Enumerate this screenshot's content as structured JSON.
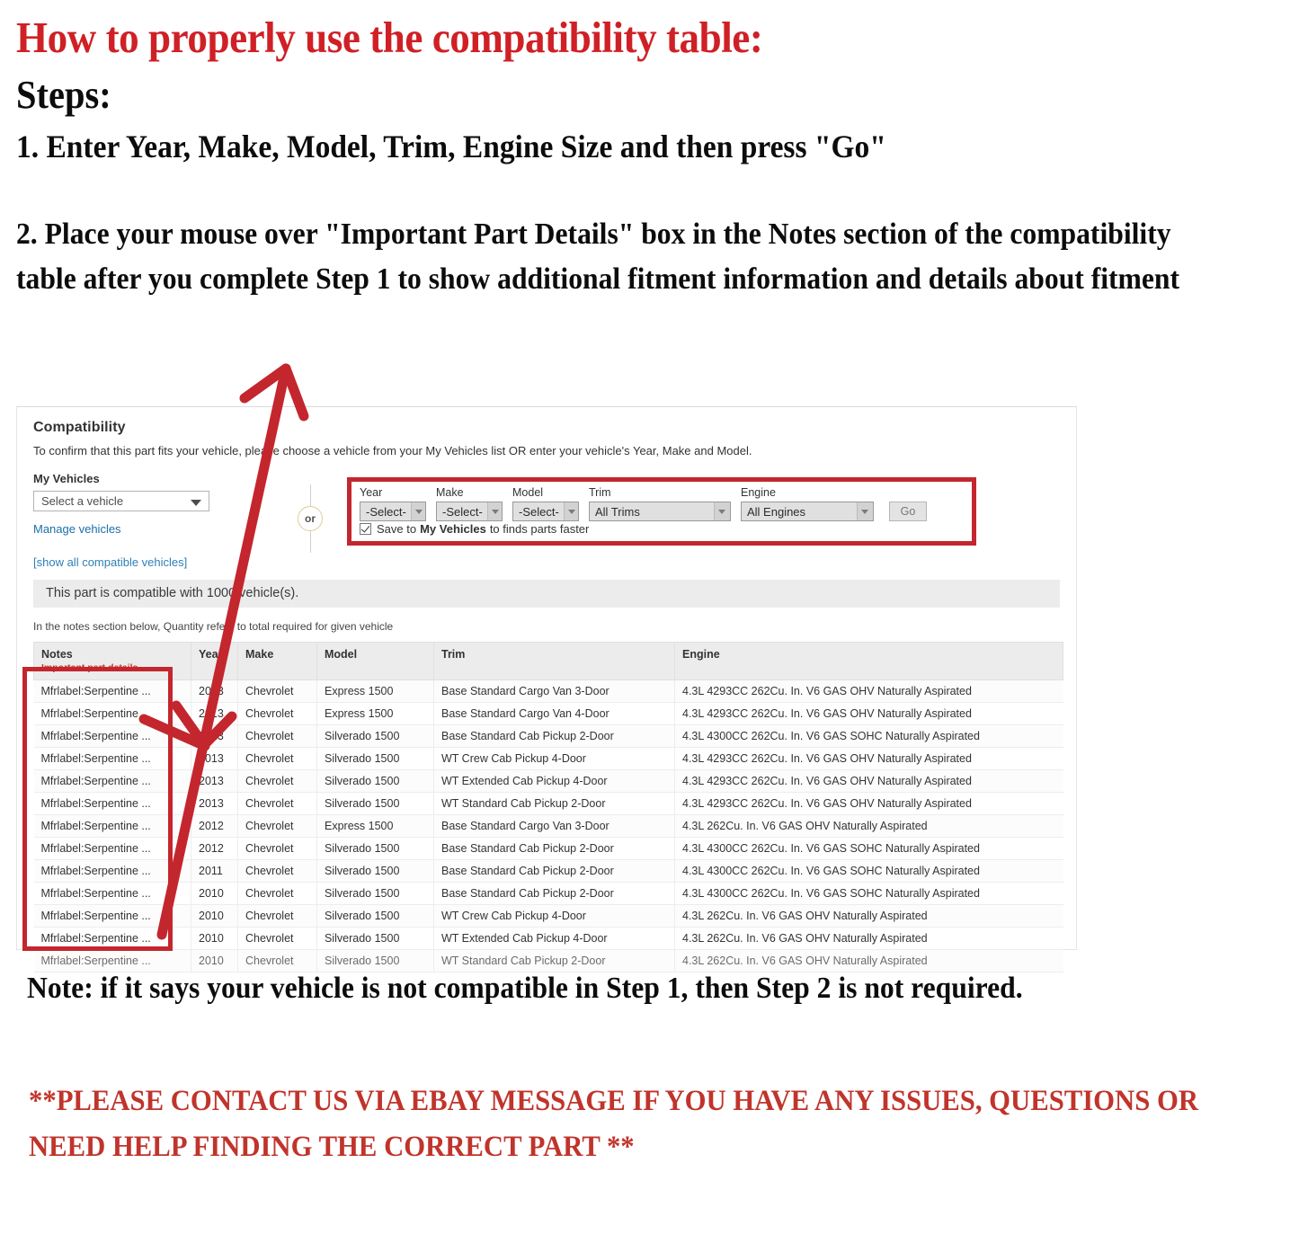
{
  "instructions": {
    "heading": "How to properly use the compatibility table:",
    "steps_label": "Steps:",
    "step1": "1. Enter Year, Make, Model, Trim, Engine Size and then press \"Go\"",
    "step2": "2. Place your mouse over \"Important Part Details\" box in the Notes section of the compatibility table after you complete Step 1 to show additional fitment information and details about fitment"
  },
  "compatibility": {
    "title": "Compatibility",
    "subtitle": "To confirm that this part fits your vehicle, please choose a vehicle from your My Vehicles list OR enter your vehicle's Year, Make and Model.",
    "my_vehicles_label": "My Vehicles",
    "vehicle_select_value": "Select a vehicle",
    "manage_vehicles_link": "Manage vehicles",
    "show_all_link": "[show all compatible vehicles]",
    "or_label": "or",
    "form": {
      "year_label": "Year",
      "year_value": "-Select-",
      "make_label": "Make",
      "make_value": "-Select-",
      "model_label": "Model",
      "model_value": "-Select-",
      "trim_label": "Trim",
      "trim_value": "All Trims",
      "engine_label": "Engine",
      "engine_value": "All Engines",
      "go_button": "Go",
      "save_prefix": "Save to",
      "save_bold": "My Vehicles",
      "save_suffix": "to finds parts faster"
    },
    "count_bar": "This part is compatible with 1000 vehicle(s).",
    "notes_hint": "In the notes section below, Quantity refers to total required for given vehicle",
    "table": {
      "headers": {
        "notes": "Notes",
        "notes_sub": "Important part details",
        "year": "Year",
        "make": "Make",
        "model": "Model",
        "trim": "Trim",
        "engine": "Engine"
      },
      "rows": [
        {
          "notes": "Mfrlabel:Serpentine ...",
          "year": "2013",
          "make": "Chevrolet",
          "model": "Express 1500",
          "trim": "Base Standard Cargo Van 3-Door",
          "engine": "4.3L 4293CC 262Cu. In. V6 GAS OHV Naturally Aspirated"
        },
        {
          "notes": "Mfrlabel:Serpentine ...",
          "year": "2013",
          "make": "Chevrolet",
          "model": "Express 1500",
          "trim": "Base Standard Cargo Van 4-Door",
          "engine": "4.3L 4293CC 262Cu. In. V6 GAS OHV Naturally Aspirated"
        },
        {
          "notes": "Mfrlabel:Serpentine ...",
          "year": "2013",
          "make": "Chevrolet",
          "model": "Silverado 1500",
          "trim": "Base Standard Cab Pickup 2-Door",
          "engine": "4.3L 4300CC 262Cu. In. V6 GAS SOHC Naturally Aspirated"
        },
        {
          "notes": "Mfrlabel:Serpentine ...",
          "year": "2013",
          "make": "Chevrolet",
          "model": "Silverado 1500",
          "trim": "WT Crew Cab Pickup 4-Door",
          "engine": "4.3L 4293CC 262Cu. In. V6 GAS OHV Naturally Aspirated"
        },
        {
          "notes": "Mfrlabel:Serpentine ...",
          "year": "2013",
          "make": "Chevrolet",
          "model": "Silverado 1500",
          "trim": "WT Extended Cab Pickup 4-Door",
          "engine": "4.3L 4293CC 262Cu. In. V6 GAS OHV Naturally Aspirated"
        },
        {
          "notes": "Mfrlabel:Serpentine ...",
          "year": "2013",
          "make": "Chevrolet",
          "model": "Silverado 1500",
          "trim": "WT Standard Cab Pickup 2-Door",
          "engine": "4.3L 4293CC 262Cu. In. V6 GAS OHV Naturally Aspirated"
        },
        {
          "notes": "Mfrlabel:Serpentine ...",
          "year": "2012",
          "make": "Chevrolet",
          "model": "Express 1500",
          "trim": "Base Standard Cargo Van 3-Door",
          "engine": "4.3L 262Cu. In. V6 GAS OHV Naturally Aspirated"
        },
        {
          "notes": "Mfrlabel:Serpentine ...",
          "year": "2012",
          "make": "Chevrolet",
          "model": "Silverado 1500",
          "trim": "Base Standard Cab Pickup 2-Door",
          "engine": "4.3L 4300CC 262Cu. In. V6 GAS SOHC Naturally Aspirated"
        },
        {
          "notes": "Mfrlabel:Serpentine ...",
          "year": "2011",
          "make": "Chevrolet",
          "model": "Silverado 1500",
          "trim": "Base Standard Cab Pickup 2-Door",
          "engine": "4.3L 4300CC 262Cu. In. V6 GAS SOHC Naturally Aspirated"
        },
        {
          "notes": "Mfrlabel:Serpentine ...",
          "year": "2010",
          "make": "Chevrolet",
          "model": "Silverado 1500",
          "trim": "Base Standard Cab Pickup 2-Door",
          "engine": "4.3L 4300CC 262Cu. In. V6 GAS SOHC Naturally Aspirated"
        },
        {
          "notes": "Mfrlabel:Serpentine ...",
          "year": "2010",
          "make": "Chevrolet",
          "model": "Silverado 1500",
          "trim": "WT Crew Cab Pickup 4-Door",
          "engine": "4.3L 262Cu. In. V6 GAS OHV Naturally Aspirated"
        },
        {
          "notes": "Mfrlabel:Serpentine ...",
          "year": "2010",
          "make": "Chevrolet",
          "model": "Silverado 1500",
          "trim": "WT Extended Cab Pickup 4-Door",
          "engine": "4.3L 262Cu. In. V6 GAS OHV Naturally Aspirated"
        },
        {
          "notes": "Mfrlabel:Serpentine ...",
          "year": "2010",
          "make": "Chevrolet",
          "model": "Silverado 1500",
          "trim": "WT Standard Cab Pickup 2-Door",
          "engine": "4.3L 262Cu. In. V6 GAS OHV Naturally Aspirated"
        }
      ]
    }
  },
  "footer": {
    "note": "Note: if it says your vehicle is not compatible in Step 1, then Step 2 is not required.",
    "contact": "**PLEASE CONTACT US VIA EBAY MESSAGE IF YOU HAVE ANY ISSUES, QUESTIONS OR NEED HELP FINDING THE CORRECT PART **"
  },
  "colors": {
    "heading_red": "#CF2026",
    "highlight_red": "#C4262E",
    "link_blue": "#1a6ea8",
    "notes_red": "#C0392B"
  }
}
